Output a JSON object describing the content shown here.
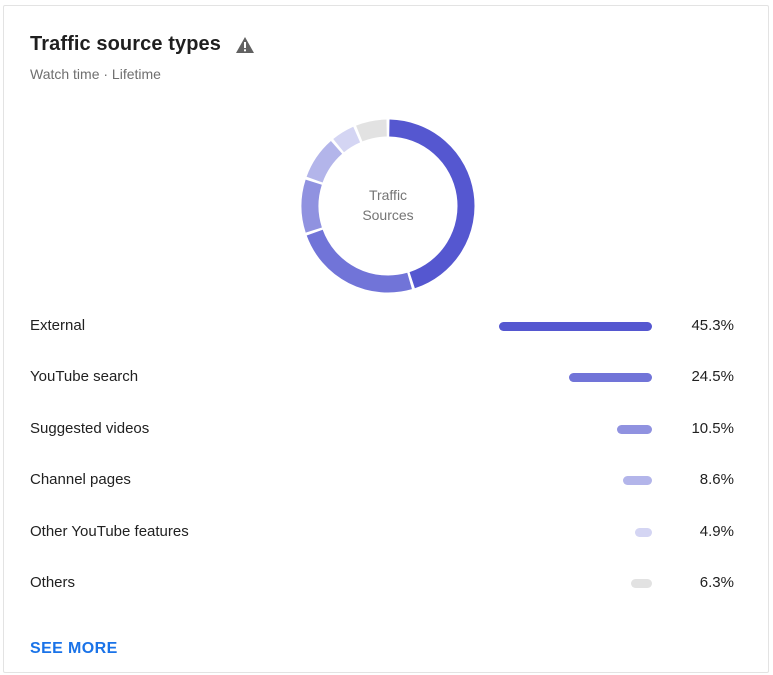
{
  "card": {
    "title": "Traffic source types",
    "subtitle": "Watch time · Lifetime",
    "warning_icon": "warning-triangle-icon",
    "see_more": "SEE MORE"
  },
  "donut": {
    "center_line1": "Traffic",
    "center_line2": "Sources"
  },
  "chart_data": {
    "type": "bar",
    "categories": [
      "External",
      "YouTube search",
      "Suggested videos",
      "Channel pages",
      "Other YouTube features",
      "Others"
    ],
    "values": [
      45.3,
      24.5,
      10.5,
      8.6,
      4.9,
      6.3
    ],
    "labels": [
      "45.3%",
      "24.5%",
      "10.5%",
      "8.6%",
      "4.9%",
      "6.3%"
    ],
    "colors": [
      "#5557d0",
      "#7174d8",
      "#9092e0",
      "#b3b5ea",
      "#d4d5f3",
      "#e2e2e2"
    ]
  },
  "colors": {
    "accent": "#1a73e8",
    "icon": "#616161"
  }
}
